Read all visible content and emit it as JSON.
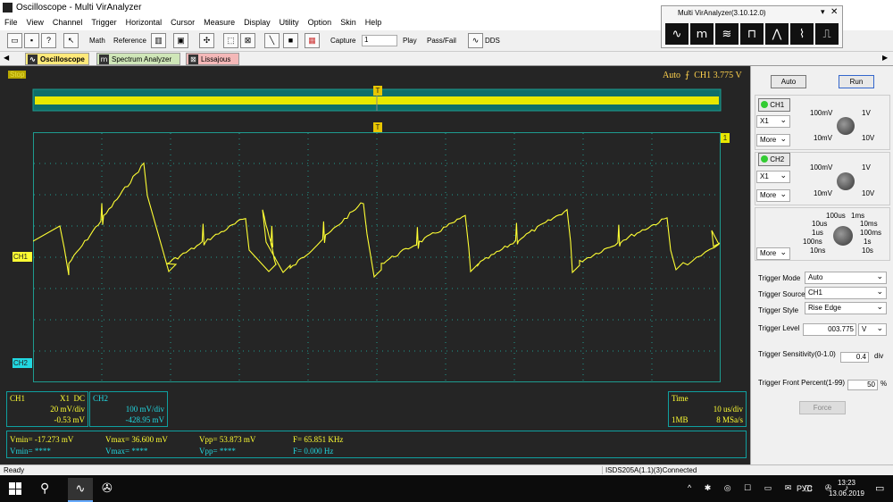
{
  "app": {
    "title": "Oscilloscope - Multi VirAnalyzer"
  },
  "menu": [
    "File",
    "View",
    "Channel",
    "Trigger",
    "Horizontal",
    "Cursor",
    "Measure",
    "Display",
    "Utility",
    "Option",
    "Skin",
    "Help"
  ],
  "toolbar": {
    "math": "Math",
    "reference": "Reference",
    "capture": "Capture",
    "capture_value": "1",
    "play": "Play",
    "passfail": "Pass/Fail",
    "dds": "DDS"
  },
  "popup": {
    "title": "Multi VirAnalyzer(3.10.12.0)"
  },
  "tabs": [
    "Oscilloscope",
    "Spectrum Analyzer",
    "Lissajous"
  ],
  "scope": {
    "state": "Stop",
    "trigger_info": "Auto",
    "trigger_ch": "CH1",
    "trigger_val": "3.775 V",
    "ch1_marker": "CH1",
    "ch2_marker": "CH2",
    "trig_marker": "T",
    "level_marker": "1"
  },
  "ch1_box": {
    "name": "CH1",
    "coupling": "X1  DC",
    "scale": "20 mV/div",
    "offset": "-0.53 mV"
  },
  "ch2_box": {
    "name": "CH2",
    "scale": "100 mV/div",
    "offset": "-428.95 mV"
  },
  "time_box": {
    "label": "Time",
    "timebase": "10 us/div",
    "depth": "1MB",
    "rate": "8 MSa/s"
  },
  "meas": {
    "ch1_vmin": "Vmin= -17.273 mV",
    "ch1_vmax": "Vmax= 36.600 mV",
    "ch1_vpp": "Vpp= 53.873 mV",
    "ch1_f": "F= 65.851 KHz",
    "ch2_vmin": "Vmin= ****",
    "ch2_vmax": "Vmax= ****",
    "ch2_vpp": "Vpp= ****",
    "ch2_f": "F= 0.000 Hz"
  },
  "right": {
    "auto": "Auto",
    "run": "Run",
    "ch1": "CH1",
    "ch2": "CH2",
    "ch1_probe": "X1",
    "ch2_probe": "X1",
    "more": "More",
    "volt_knob": {
      "l1": "100mV",
      "l2": "1V",
      "l3": "10mV",
      "l4": "10V"
    },
    "time_knob": {
      "l1": "100us",
      "l2": "1ms",
      "l3": "10us",
      "l4": "10ms",
      "l5": "1us",
      "l6": "100ms",
      "l7": "100ns",
      "l8": "1s",
      "l9": "10ns",
      "l10": "10s"
    },
    "trigger_mode_label": "Trigger Mode",
    "trigger_mode": "Auto",
    "trigger_source_label": "Trigger Source",
    "trigger_source": "CH1",
    "trigger_style_label": "Trigger Style",
    "trigger_style": "Rise Edge",
    "trigger_level_label": "Trigger Level",
    "trigger_level": "003.775",
    "trigger_level_unit": "V",
    "sensitivity_label": "Trigger Sensitivity(0-1.0)",
    "sensitivity": "0.4",
    "sensitivity_unit": "div",
    "front_label": "Trigger Front Percent(1-99)",
    "front": "50",
    "front_unit": "%",
    "force": "Force"
  },
  "status": {
    "left": "Ready",
    "right": "ISDS205A(1.1)(3)Connected"
  },
  "taskbar": {
    "lang": "РУС",
    "time": "13:23",
    "date": "13.06.2019"
  },
  "colors": {
    "ch1": "#ffff33",
    "ch2": "#22d7e0",
    "grid": "#1e9b8f",
    "bg": "#252525"
  },
  "chart_data": {
    "type": "line",
    "series": [
      {
        "name": "CH1",
        "description_free": true
      }
    ]
  }
}
